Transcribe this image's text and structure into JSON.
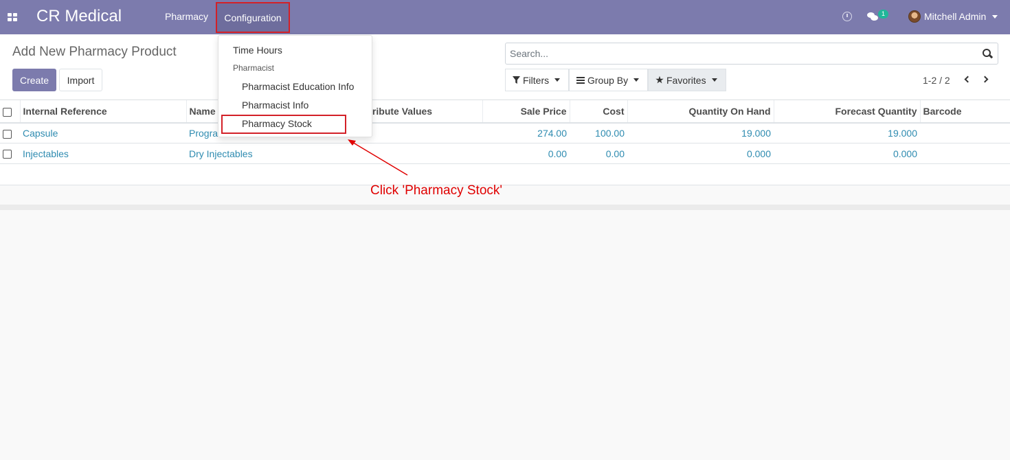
{
  "navbar": {
    "brand": "CR Medical",
    "menu": [
      {
        "label": "Pharmacy"
      },
      {
        "label": "Configuration"
      }
    ],
    "chat_badge": "1",
    "user": "Mitchell Admin"
  },
  "control_panel": {
    "breadcrumb": "Add New Pharmacy Product",
    "create_label": "Create",
    "import_label": "Import",
    "search_placeholder": "Search...",
    "filters_label": "Filters",
    "groupby_label": "Group By",
    "favorites_label": "Favorites",
    "pager": "1-2 / 2"
  },
  "table": {
    "columns": {
      "internal_reference": "Internal Reference",
      "name": "Name",
      "attributes": "Attribute Values",
      "sale_price": "Sale Price",
      "cost": "Cost",
      "qty_on_hand": "Quantity On Hand",
      "forecast_qty": "Forecast Quantity",
      "barcode": "Barcode"
    },
    "rows": [
      {
        "internal_reference": "Capsule",
        "name": "Programmable",
        "attributes": "",
        "sale_price": "274.00",
        "cost": "100.00",
        "qty_on_hand": "19.000",
        "forecast_qty": "19.000",
        "barcode": ""
      },
      {
        "internal_reference": "Injectables",
        "name": "Dry Injectables",
        "attributes": "",
        "sale_price": "0.00",
        "cost": "0.00",
        "qty_on_hand": "0.000",
        "forecast_qty": "0.000",
        "barcode": ""
      }
    ]
  },
  "dropdown": {
    "time_hours": "Time Hours",
    "pharmacist_header": "Pharmacist",
    "education_info": "Pharmacist Education Info",
    "pharmacist_info": "Pharmacist Info",
    "pharmacy_stock": "Pharmacy Stock"
  },
  "annotation": {
    "text": "Click 'Pharmacy Stock'",
    "color": "#e00000"
  },
  "colors": {
    "brand": "#7c7bad",
    "link": "#2e8bb0",
    "highlight": "#d32027"
  }
}
